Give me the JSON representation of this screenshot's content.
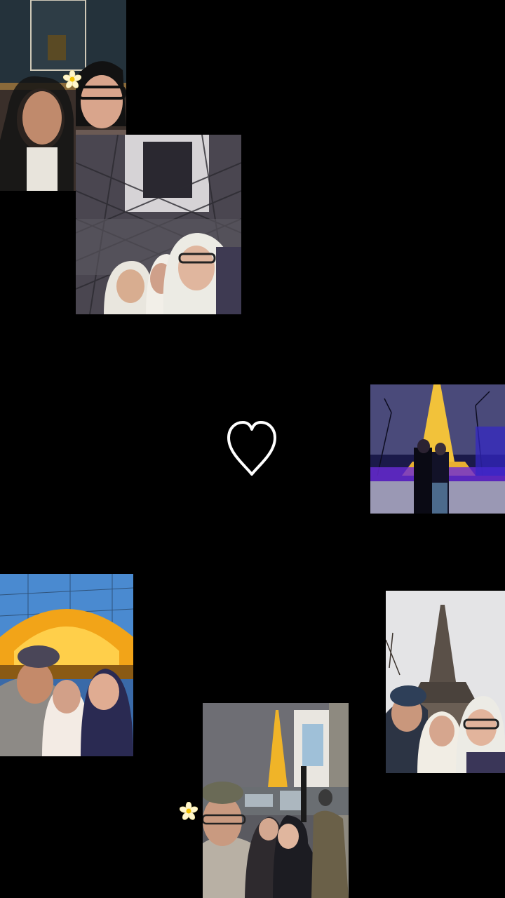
{
  "canvas": {
    "background": "#000000"
  },
  "photos": [
    {
      "id": "photo-mona-lisa-selfie",
      "icon": "photo",
      "accent": "#2a3a4a"
    },
    {
      "id": "photo-eiffel-underneath-selfie",
      "icon": "photo",
      "accent": "#6d6a72"
    },
    {
      "id": "photo-eiffel-night-couple",
      "icon": "photo",
      "accent": "#3b2fd6"
    },
    {
      "id": "photo-eiffel-golden-selfie",
      "icon": "photo",
      "accent": "#f0a020"
    },
    {
      "id": "photo-eiffel-daylight-selfie",
      "icon": "photo",
      "accent": "#d9d9dc"
    },
    {
      "id": "photo-louvre-night-selfie",
      "icon": "photo",
      "accent": "#c8a030"
    }
  ],
  "icons": {
    "heart": "heart-outline-icon",
    "flower": "flower-sticker-icon"
  },
  "colors": {
    "heart_stroke": "#ffffff",
    "flower_petal": "#fff6cc",
    "flower_center": "#f2c200"
  }
}
